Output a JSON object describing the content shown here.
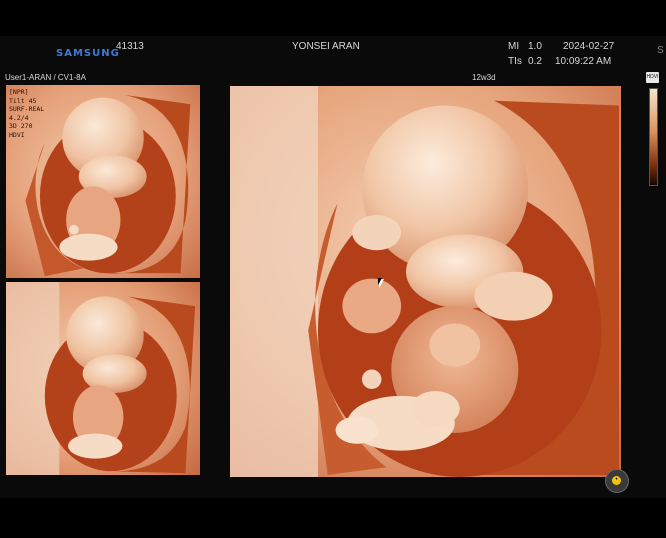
{
  "header": {
    "brand": "SAMSUNG",
    "patient_id": "41313",
    "institution": "YONSEI ARAN",
    "mi_label": "MI",
    "mi_value": "1.0",
    "tis_label": "TIs",
    "tis_value": "0.2",
    "date": "2024-02-27",
    "time": "10:09:22 AM",
    "edge_char": "S"
  },
  "subheader": {
    "user_probe": "User1-ARAN / CV1-8A",
    "gestational_age": "12w3d"
  },
  "overlay": {
    "lines": [
      "[NPR]",
      "Tilt 45",
      "SURF-REAL",
      "4.2/4",
      "3D 270",
      "HDVI"
    ]
  },
  "colorbar": {
    "badge": "HDVI"
  },
  "colors": {
    "background": "#000000",
    "tissue_light": "#f6dcc4",
    "tissue_mid": "#e29a6c",
    "tissue_dark": "#a83a12",
    "brand_blue": "#3d7bd4"
  }
}
